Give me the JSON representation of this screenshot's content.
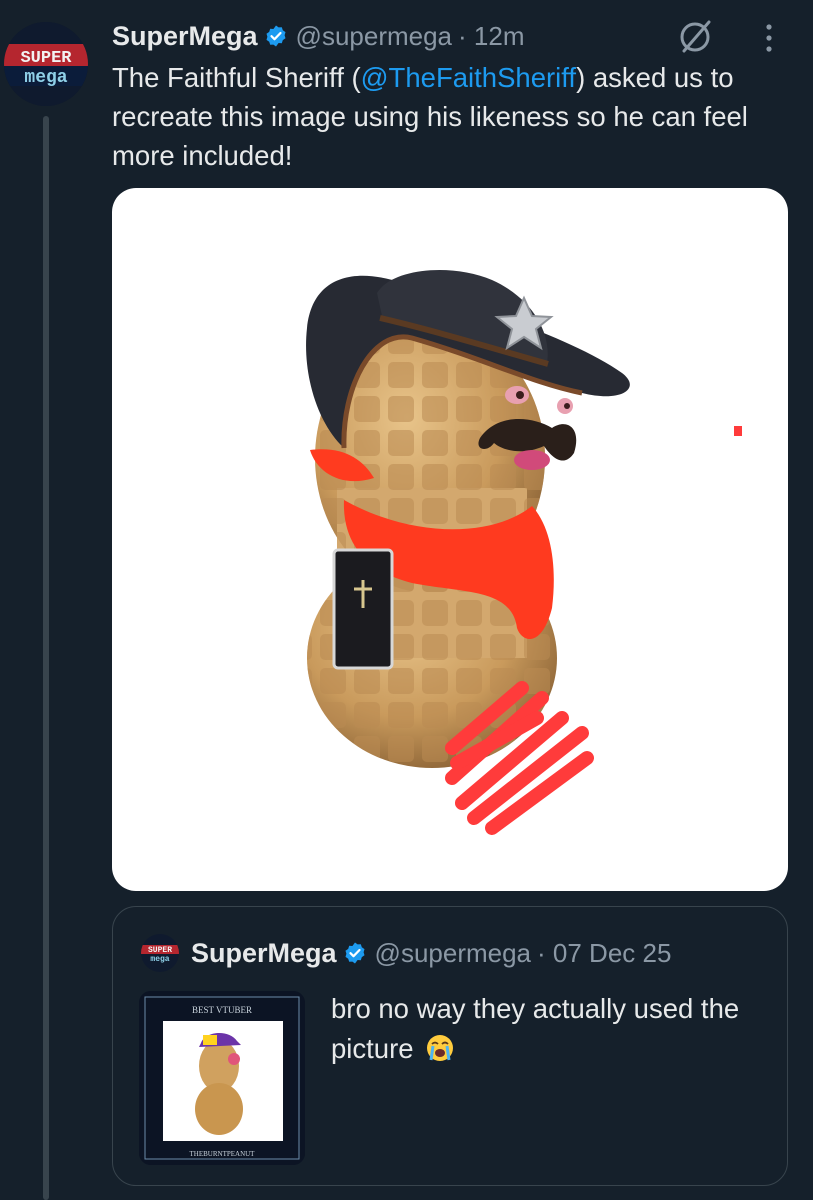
{
  "tweet": {
    "author_name": "SuperMega",
    "author_handle": "@supermega",
    "time": "· 12m",
    "text_before": "The Faithful Sheriff (",
    "mention": "@TheFaithSheriff",
    "text_after": ") asked us to recreate this image using his likeness so he can feel more included!",
    "avatar_label_top": "SUPER",
    "avatar_label_bottom": "mega"
  },
  "quote": {
    "author_name": "SuperMega",
    "author_handle": "@supermega",
    "date": "· 07 Dec 25",
    "text": "bro no way they actually used the picture",
    "emoji": "loudly-crying-face",
    "thumb_title": "BEST VTUBER",
    "thumb_footer": "THEBURNTPEANUT"
  },
  "icons": {
    "verified": "verified-badge-icon",
    "grok": "grok-icon",
    "more": "more-options-icon"
  },
  "colors": {
    "background": "#15202b",
    "accent": "#1d9bf0",
    "muted": "#8b98a5",
    "border": "#38444d"
  }
}
